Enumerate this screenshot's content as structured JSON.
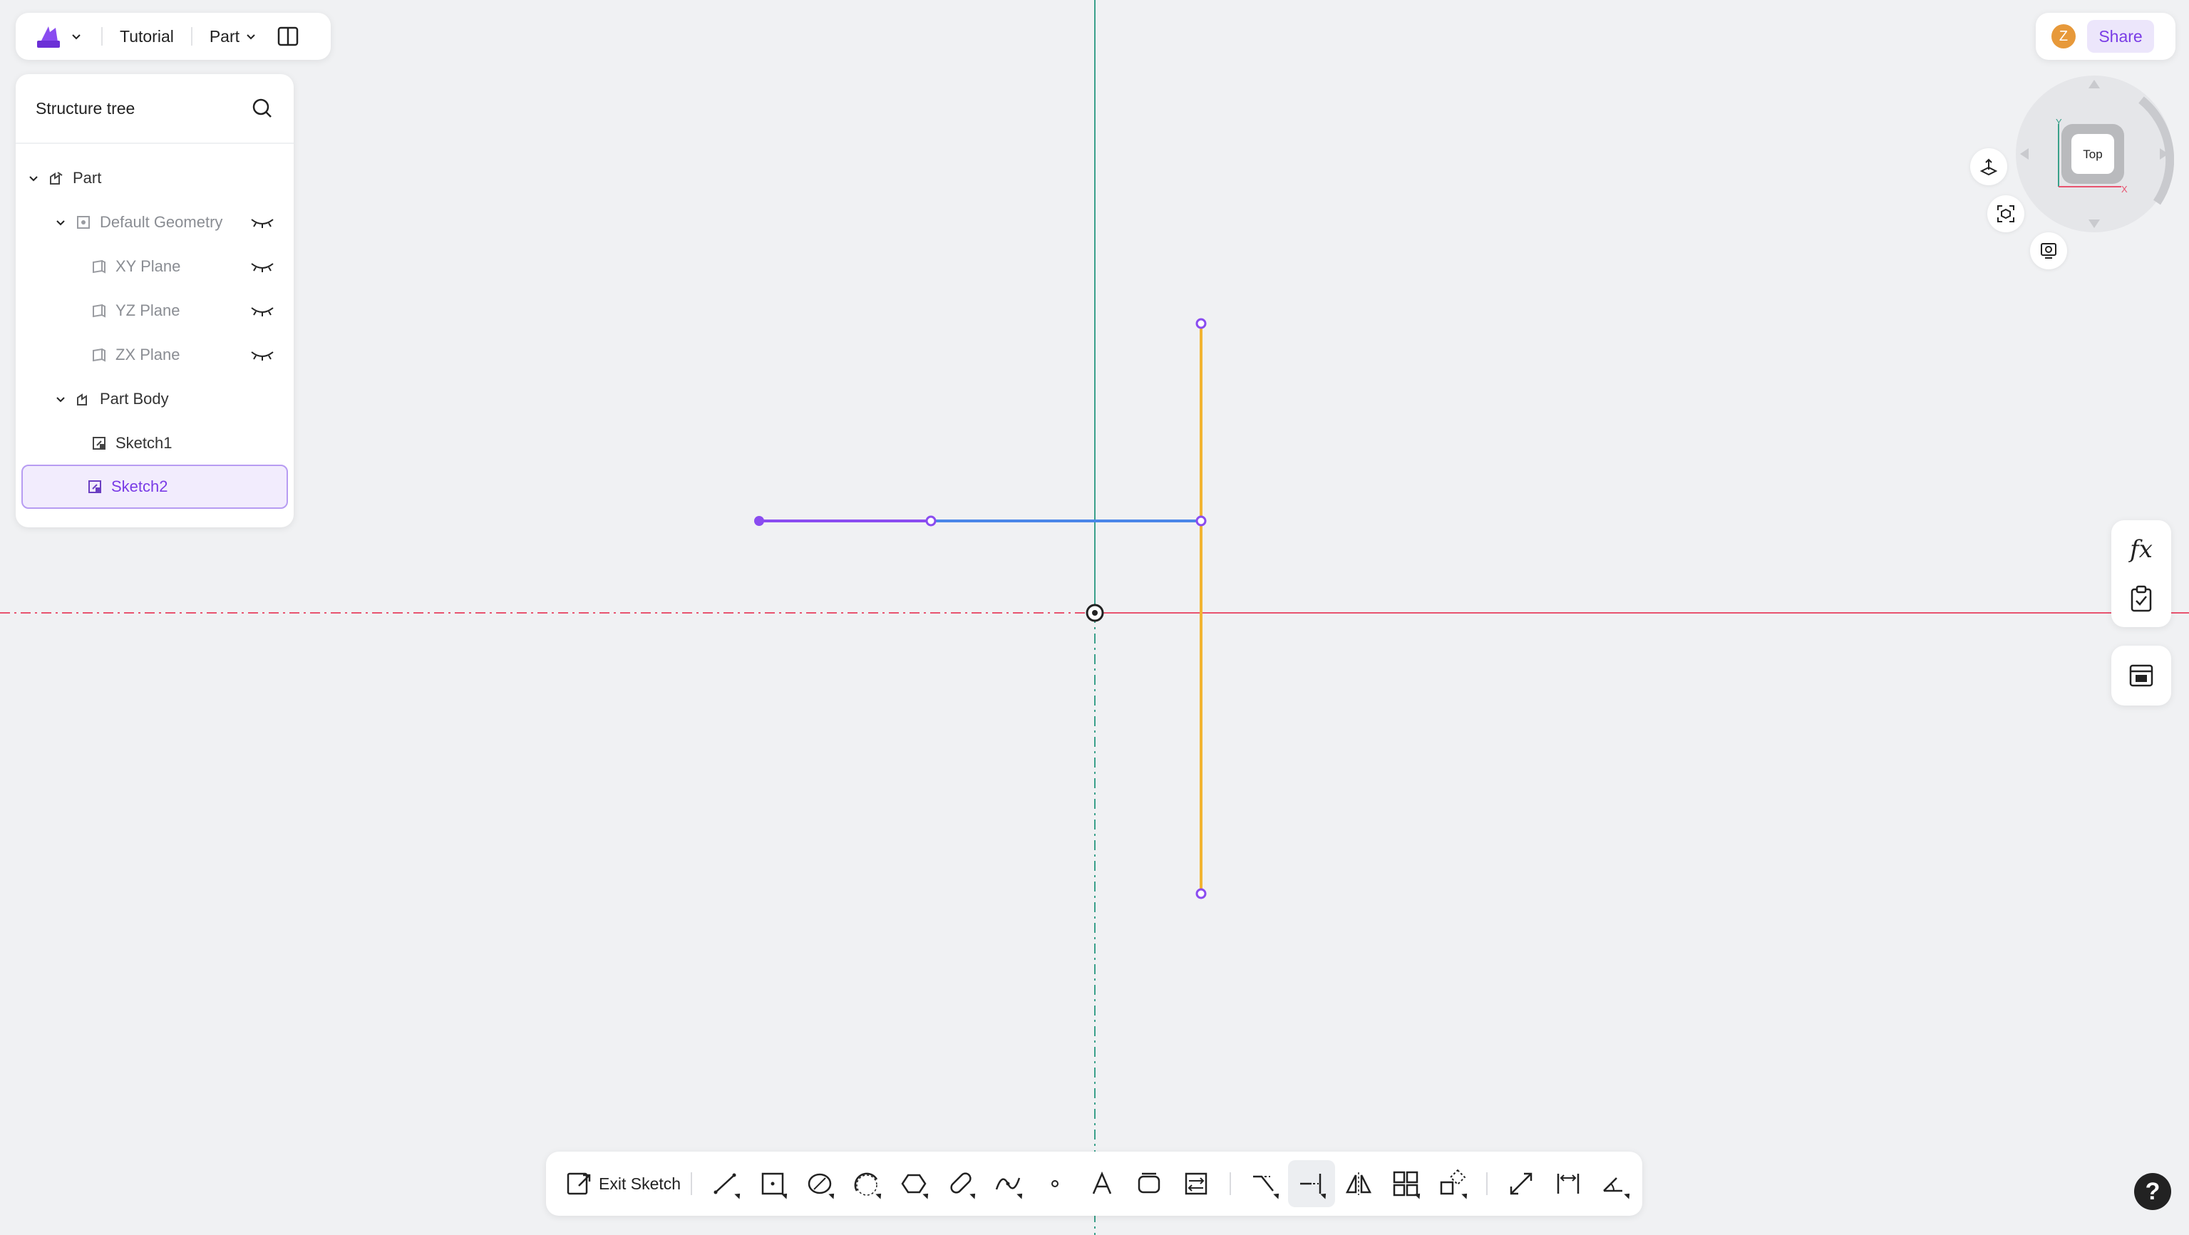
{
  "app": {
    "project_name": "Tutorial",
    "mode_label": "Part"
  },
  "structure_tree": {
    "title": "Structure tree",
    "items": [
      {
        "label": "Part"
      },
      {
        "label": "Default Geometry"
      },
      {
        "label": "XY Plane"
      },
      {
        "label": "YZ Plane"
      },
      {
        "label": "ZX Plane"
      },
      {
        "label": "Part Body"
      },
      {
        "label": "Sketch1"
      },
      {
        "label": "Sketch2",
        "selected": true
      }
    ]
  },
  "header_right": {
    "avatar_initial": "Z",
    "share_label": "Share"
  },
  "view_cube": {
    "face_label": "Top",
    "axis_y": "Y",
    "axis_x": "X"
  },
  "side_tools": {
    "formula_label": "fx"
  },
  "toolbar": {
    "exit_label": "Exit Sketch",
    "tools": [
      "line-tool",
      "rectangle-tool",
      "circle-tool",
      "arc-tool",
      "polygon-tool",
      "slot-tool",
      "spline-tool",
      "point-tool",
      "text-tool",
      "fillet-tool",
      "offset-tool",
      "trim-tool",
      "extend-tool",
      "mirror-tool",
      "pattern-tool",
      "transform-tool",
      "convert-tool",
      "dimension-tool",
      "angle-tool"
    ],
    "active_tool": "extend-tool"
  },
  "help_label": "?",
  "colors": {
    "accent": "#7a3ce6",
    "x_axis": "#e8536f",
    "y_axis": "#3aa08a",
    "sketch_line": "#8a4cf0",
    "construction_line": "#4a86e8",
    "highlight_line": "#f2b431"
  }
}
